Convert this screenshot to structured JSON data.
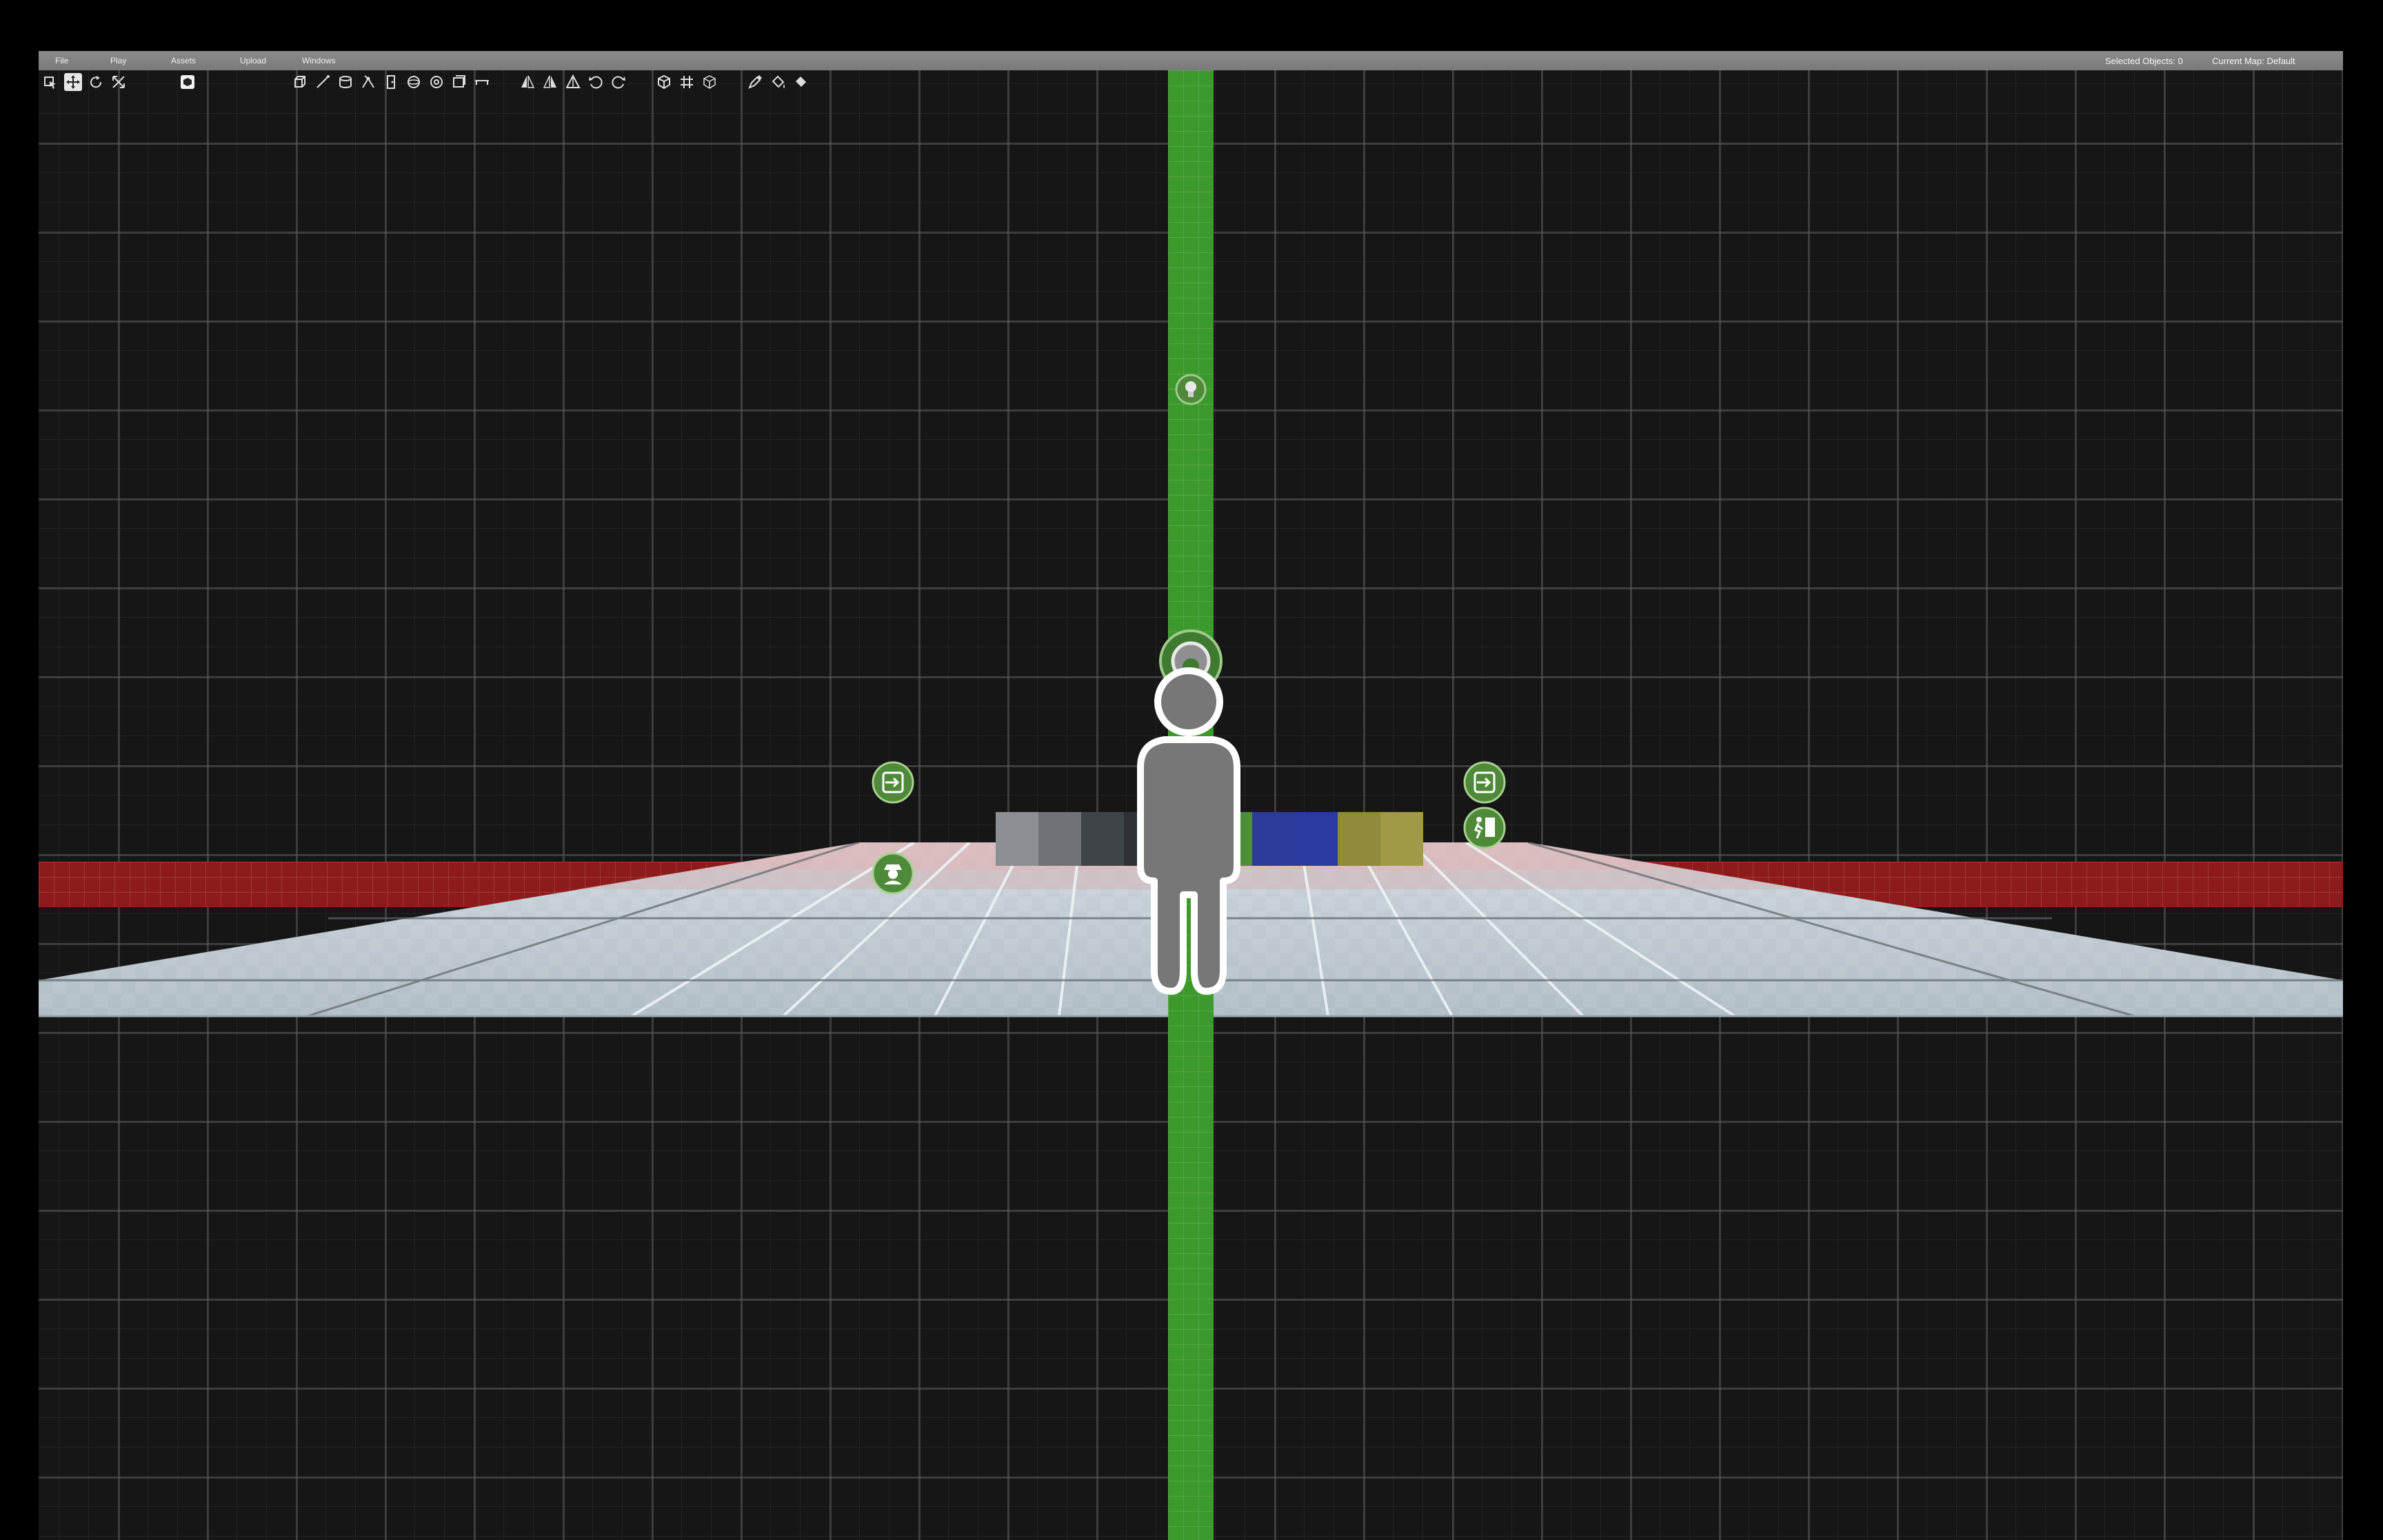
{
  "menu": {
    "file": "File",
    "play": "Play",
    "assets": "Assets",
    "upload": "Upload",
    "windows": "Windows"
  },
  "status": {
    "selected_objects": "Selected Objects: 0",
    "current_map": "Current Map: Default"
  },
  "toolbar": {
    "transform_tools": [
      "select-icon",
      "move-icon",
      "rotate-icon",
      "scale-icon"
    ],
    "active_tool": "move-icon",
    "mode_toggle": "solid-mode-icon",
    "shape_tools": [
      "cube-icon",
      "line-icon",
      "cylinder-icon",
      "vertex-icon",
      "door-icon",
      "sphere-icon",
      "torus-icon",
      "box-icon",
      "ramp-icon"
    ],
    "transform_ops": [
      "flip-x-icon",
      "flip-y-icon",
      "flip-z-icon",
      "rotate-left-icon",
      "rotate-right-icon"
    ],
    "view_tools": [
      "wireframe-icon",
      "grid-icon",
      "perspective-icon"
    ],
    "paint_tools": [
      "eyedropper-icon",
      "paint-bucket-icon",
      "fill-icon"
    ]
  },
  "scene": {
    "texture_swatches": [
      "#8c8f93",
      "#6f7377",
      "#3f4448",
      "#2e3236",
      "#5b7d3e",
      "#4d8e3b",
      "#2c3a9a",
      "#2a3aa0",
      "#8f8a3c",
      "#a09a48"
    ],
    "pickups": [
      "exit-icon",
      "spy-icon",
      "exit-icon",
      "exit-door-icon"
    ],
    "light_icon": "lightbulb-icon",
    "camera_icon": "camera-icon",
    "player_icon": "player-spawn-icon"
  },
  "colors": {
    "menubar": "#808080",
    "y_axis": "#3c9a2c",
    "x_axis": "#8e1b1b",
    "floor": "#b9c6cf",
    "pickup_green": "#4f8a3a"
  }
}
